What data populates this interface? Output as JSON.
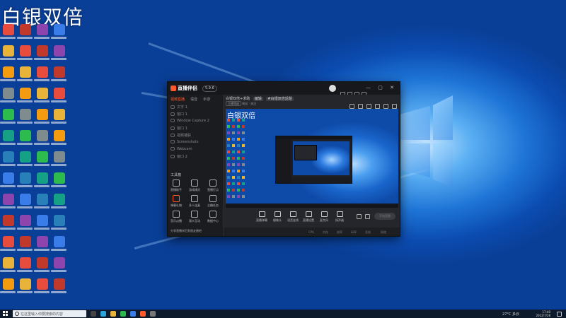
{
  "desktop": {
    "watermark": "白银双倍"
  },
  "app": {
    "logo_text": "直播伴侣",
    "version_badge": "5.9.6",
    "window_controls": "— ▢ ✕",
    "sidebar": {
      "tabs": [
        "视频直播",
        "语音",
        "手游"
      ],
      "scene_rows": [
        "文字 1",
        "窗口 1",
        "Window Capture 2",
        "窗口 1",
        "视频捕获",
        "Screenshots",
        "Webcam",
        "窗口 2"
      ],
      "tools_title": "工具箱",
      "tools": [
        "直播助手",
        "游戏精灵",
        "直播打点",
        "弹幕礼物",
        "多人连麦",
        "主播任务",
        "音乐点播",
        "观众互动",
        "数据中心"
      ],
      "footer": "分享直播伴侣到朋友圈吧"
    },
    "main": {
      "room_title": "白银双倍+求助",
      "room_tag": "编辑",
      "room_subtag": "#白银双倍话题",
      "meta_tag": "主播等级",
      "meta_text": "粉丝 · 关注",
      "preview_watermark": "白银双倍",
      "controls": [
        "直播弹幕",
        "摄像头",
        "语音连线",
        "直播设置",
        "麦克风",
        "扬声器"
      ],
      "golive_label": "开始直播",
      "status": [
        "CPU",
        "内存",
        "帧率",
        "码率",
        "丢帧",
        "网络"
      ]
    }
  },
  "taskbar": {
    "search_placeholder": "在这里输入你要搜索的内容",
    "weather": "27°C 多云",
    "time": "17:40",
    "date": "2022/7/28"
  },
  "colors": {
    "accent": "#ff5a2c",
    "desktop_blue": "#1e74d6"
  }
}
